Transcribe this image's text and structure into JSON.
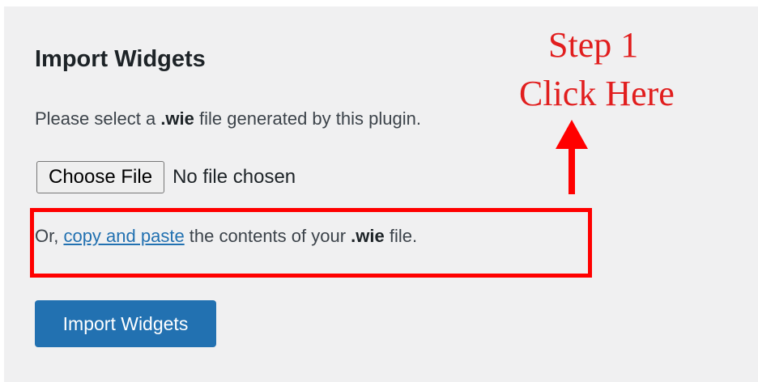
{
  "panel": {
    "title": "Import Widgets",
    "description": {
      "before": "Please select a ",
      "ext": ".wie",
      "after": " file generated by this plugin."
    },
    "file_input": {
      "button_label": "Choose File",
      "status": "No file chosen"
    },
    "paste": {
      "prefix": "Or, ",
      "link_text": "copy and paste",
      "middle": " the contents of your ",
      "ext": ".wie",
      "suffix": " file."
    },
    "submit_label": "Import Widgets"
  },
  "annotation": {
    "line1": "Step 1",
    "line2": "Click Here",
    "color": "#e11e1e",
    "highlight_color": "#ff0000"
  },
  "colors": {
    "primary": "#2271b1",
    "background": "#f0f0f1",
    "text": "#3c434a"
  }
}
